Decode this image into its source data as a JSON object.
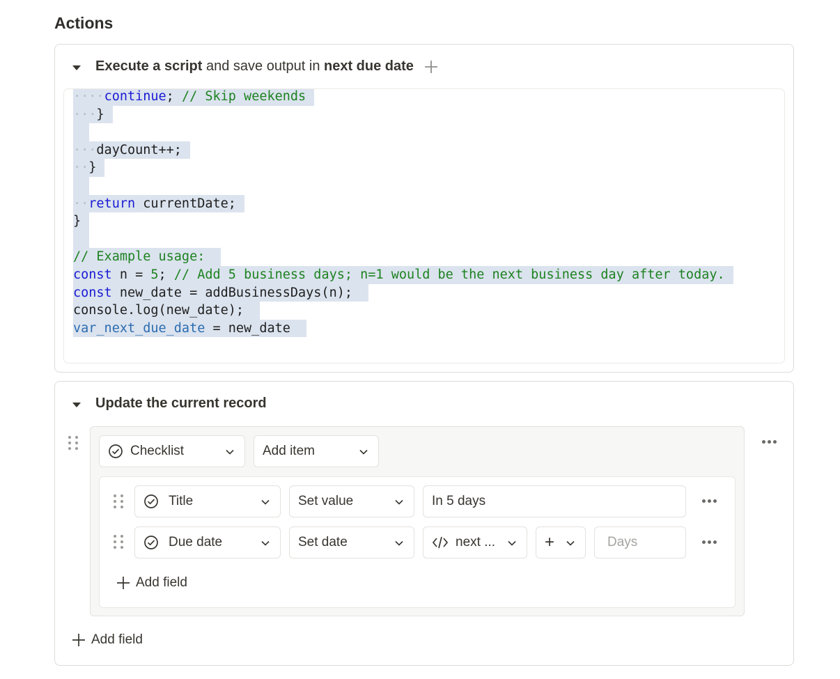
{
  "section_title": "Actions",
  "script_action": {
    "label_bold": "Execute a script",
    "label_mid": " and save output in ",
    "output_var": "next due date",
    "code_lines": [
      {
        "indent": "····",
        "tokens": [
          {
            "t": "continue",
            "c": "kw"
          },
          {
            "t": "; ",
            "c": ""
          },
          {
            "t": "// Skip weekends",
            "c": "cm"
          }
        ]
      },
      {
        "indent": "···",
        "tokens": [
          {
            "t": "}",
            "c": ""
          }
        ]
      },
      {
        "indent": " ",
        "tokens": []
      },
      {
        "indent": "···",
        "tokens": [
          {
            "t": "dayCount++;",
            "c": ""
          }
        ]
      },
      {
        "indent": "··",
        "tokens": [
          {
            "t": "}",
            "c": ""
          }
        ]
      },
      {
        "indent": " ",
        "tokens": []
      },
      {
        "indent": "··",
        "tokens": [
          {
            "t": "return",
            "c": "kw"
          },
          {
            "t": " currentDate;",
            "c": ""
          }
        ]
      },
      {
        "indent": "",
        "tokens": [
          {
            "t": "}",
            "c": ""
          }
        ]
      },
      {
        "indent": " ",
        "tokens": []
      },
      {
        "indent": "",
        "tokens": [
          {
            "t": "// Example usage: ",
            "c": "cm"
          }
        ]
      },
      {
        "indent": "",
        "tokens": [
          {
            "t": "const",
            "c": "kw"
          },
          {
            "t": " n = ",
            "c": ""
          },
          {
            "t": "5",
            "c": "num"
          },
          {
            "t": "; ",
            "c": ""
          },
          {
            "t": "// Add 5 business days; n=1 would be the next business day after today.",
            "c": "cm"
          }
        ]
      },
      {
        "indent": "",
        "tokens": [
          {
            "t": "const",
            "c": "kw"
          },
          {
            "t": " new_date = addBusinessDays(n); ",
            "c": ""
          }
        ]
      },
      {
        "indent": "",
        "tokens": [
          {
            "t": "console.log(new_date); ",
            "c": ""
          }
        ]
      },
      {
        "indent": "",
        "tokens": [
          {
            "t": "var_next_due_date",
            "c": "var"
          },
          {
            "t": " = new_date ",
            "c": ""
          }
        ]
      }
    ]
  },
  "update_action": {
    "label": "Update the current record",
    "property_select": "Checklist",
    "operation_select": "Add item",
    "rows": [
      {
        "field": "Title",
        "op": "Set value",
        "value": "In 5 days"
      },
      {
        "field": "Due date",
        "op": "Set date",
        "variable": "next ...",
        "modifier": "+",
        "days_placeholder": "Days"
      }
    ],
    "inner_add_field": "Add field",
    "outer_add_field": "Add field"
  }
}
